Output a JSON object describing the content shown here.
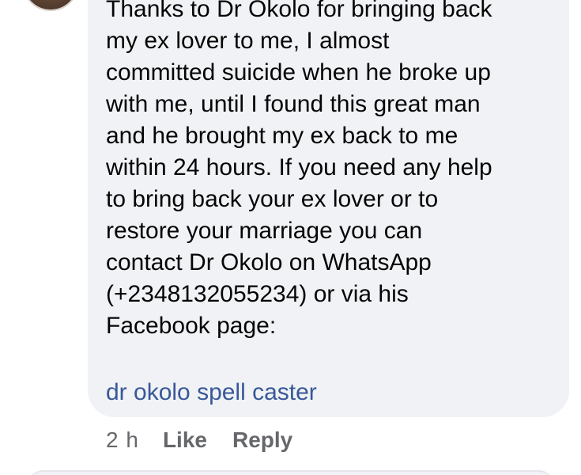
{
  "comment": {
    "lines": [
      "Thanks to Dr Okolo for bringing back",
      "my ex lover to me, I almost",
      "committed suicide when he broke up",
      "with me, until I found this great man",
      "and he brought my ex back to me",
      "within 24 hours. If you need any help",
      "to bring back your ex lover or to",
      "restore your marriage you can",
      "contact Dr Okolo on WhatsApp",
      "(+2348132055234) or via his",
      "Facebook page:"
    ],
    "link_text": "dr okolo spell caster"
  },
  "actions": {
    "time": "2 h",
    "like_label": "Like",
    "reply_label": "Reply"
  },
  "colors": {
    "bubble_bg": "#f0f2f5",
    "link": "#385898",
    "meta_text": "#65676b"
  }
}
